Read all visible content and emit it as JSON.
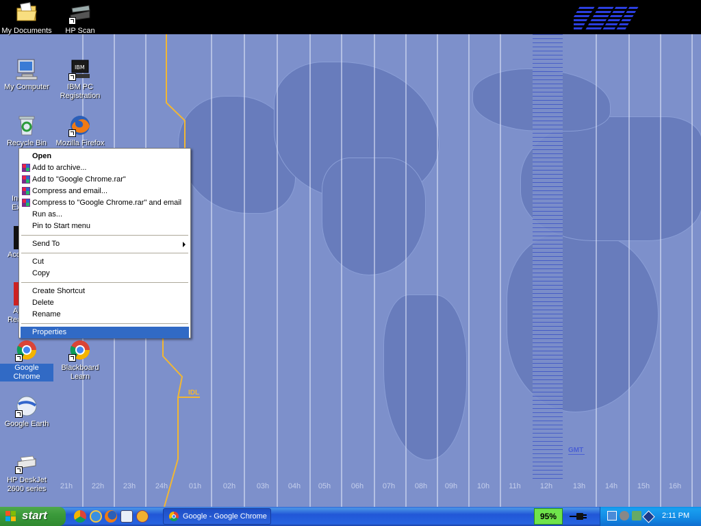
{
  "desktop": {
    "icons": [
      {
        "id": "my-documents",
        "label": "My Documents"
      },
      {
        "id": "hp-scan",
        "label": "HP Scan"
      },
      {
        "id": "my-computer",
        "label": "My Computer"
      },
      {
        "id": "ibm-pc-registration",
        "label": "IBM PC Registration"
      },
      {
        "id": "recycle-bin",
        "label": "Recycle Bin"
      },
      {
        "id": "mozilla-firefox",
        "label": "Mozilla Firefox"
      },
      {
        "id": "google-chrome",
        "label": "Google Chrome"
      },
      {
        "id": "blackboard-learn",
        "label": "Blackboard Learn"
      },
      {
        "id": "google-earth",
        "label": "Google Earth"
      },
      {
        "id": "hp-deskjet",
        "label": "HP DeskJet 2600 series"
      }
    ],
    "partial_labels": [
      "In",
      "Ex",
      "Acc",
      "A",
      "Rea"
    ]
  },
  "wallpaper": {
    "brand": "IBM",
    "idl_label": "IDL",
    "gmt_label": "GMT",
    "time_zones": [
      "21h",
      "22h",
      "23h",
      "24h",
      "01h",
      "02h",
      "03h",
      "04h",
      "05h",
      "06h",
      "07h",
      "08h",
      "09h",
      "10h",
      "11h",
      "12h",
      "13h",
      "14h",
      "15h",
      "16h"
    ]
  },
  "context_menu": {
    "items": [
      {
        "label": "Open",
        "bold": true
      },
      {
        "label": "Add to archive...",
        "icon": "winrar-icon"
      },
      {
        "label": "Add to \"Google Chrome.rar\"",
        "icon": "winrar-icon"
      },
      {
        "label": "Compress and email...",
        "icon": "winrar-icon"
      },
      {
        "label": "Compress to \"Google Chrome.rar\" and email",
        "icon": "winrar-icon"
      },
      {
        "label": "Run as..."
      },
      {
        "label": "Pin to Start menu"
      },
      {
        "label": "Send To",
        "submenu": true
      },
      {
        "label": "Cut"
      },
      {
        "label": "Copy"
      },
      {
        "label": "Create Shortcut"
      },
      {
        "label": "Delete"
      },
      {
        "label": "Rename"
      },
      {
        "label": "Properties",
        "highlighted": true
      }
    ]
  },
  "taskbar": {
    "start_label": "start",
    "quick_launch": [
      "chrome-icon",
      "internet-explorer-icon",
      "firefox-icon",
      "outlook-icon",
      "media-player-icon"
    ],
    "tasks": [
      {
        "label": "Google - Google Chrome"
      }
    ],
    "battery_percent": "95%",
    "clock": "2:11 PM"
  },
  "colors": {
    "selection": "#316ac5",
    "taskbar_blue": "#2157d7",
    "start_green": "#3b9a3b",
    "idl_line": "#f2b733",
    "gmt_band": "#3f55c7"
  }
}
